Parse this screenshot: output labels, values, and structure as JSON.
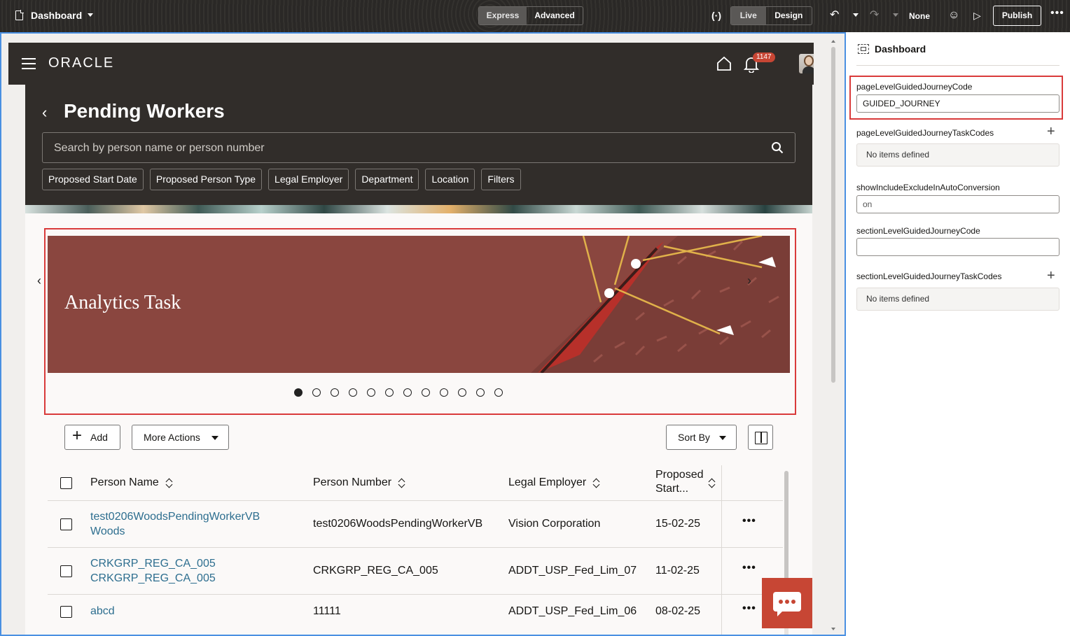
{
  "topbar": {
    "title": "Dashboard",
    "mode_express": "Express",
    "mode_advanced": "Advanced",
    "view_live": "Live",
    "view_design": "Design",
    "none_label": "None",
    "publish_label": "Publish"
  },
  "app": {
    "logo": "ORACLE",
    "notification_count": "1147",
    "page_title": "Pending Workers",
    "search_placeholder": "Search by person name or person number",
    "filters": [
      "Proposed Start Date",
      "Proposed Person Type",
      "Legal Employer",
      "Department",
      "Location",
      "Filters"
    ],
    "banner": {
      "title": "Analytics Task",
      "dot_count": 12,
      "active_dot": 0,
      "colors": {
        "background": "#8a463f"
      }
    },
    "toolbar": {
      "add_label": "Add",
      "more_actions_label": "More Actions",
      "sort_by_label": "Sort By"
    },
    "table": {
      "headers": {
        "person_name": "Person Name",
        "person_number": "Person Number",
        "legal_employer": "Legal Employer",
        "proposed_start_1": "Proposed",
        "proposed_start_2": "Start..."
      },
      "rows": [
        {
          "name_line1": "test0206WoodsPendingWorkerVB",
          "name_line2": "Woods",
          "number": "test0206WoodsPendingWorkerVB",
          "employer": "Vision Corporation",
          "start": "15-02-25"
        },
        {
          "name_line1": "CRKGRP_REG_CA_005",
          "name_line2": "CRKGRP_REG_CA_005",
          "number": "CRKGRP_REG_CA_005",
          "employer": "ADDT_USP_Fed_Lim_07",
          "start": "11-02-25"
        },
        {
          "name_line1": "abcd",
          "name_line2": "",
          "number": "11111",
          "employer": "ADDT_USP_Fed_Lim_06",
          "start": "08-02-25"
        }
      ]
    }
  },
  "panel": {
    "title": "Dashboard",
    "props": {
      "page_journey_code_label": "pageLevelGuidedJourneyCode",
      "page_journey_code_value": "GUIDED_JOURNEY",
      "page_task_codes_label": "pageLevelGuidedJourneyTaskCodes",
      "page_task_codes_empty": "No items defined",
      "show_include_label": "showIncludeExcludeInAutoConversion",
      "show_include_value": "on",
      "section_journey_code_label": "sectionLevelGuidedJourneyCode",
      "section_journey_code_value": "",
      "section_task_codes_label": "sectionLevelGuidedJourneyTaskCodes",
      "section_task_codes_empty": "No items defined"
    }
  },
  "colors": {
    "brand_red": "#c74634",
    "highlight_outline": "#d93a3a",
    "canvas_outline": "#4a90e2",
    "link": "#2d6e8f",
    "header_dark": "#312d2a"
  }
}
